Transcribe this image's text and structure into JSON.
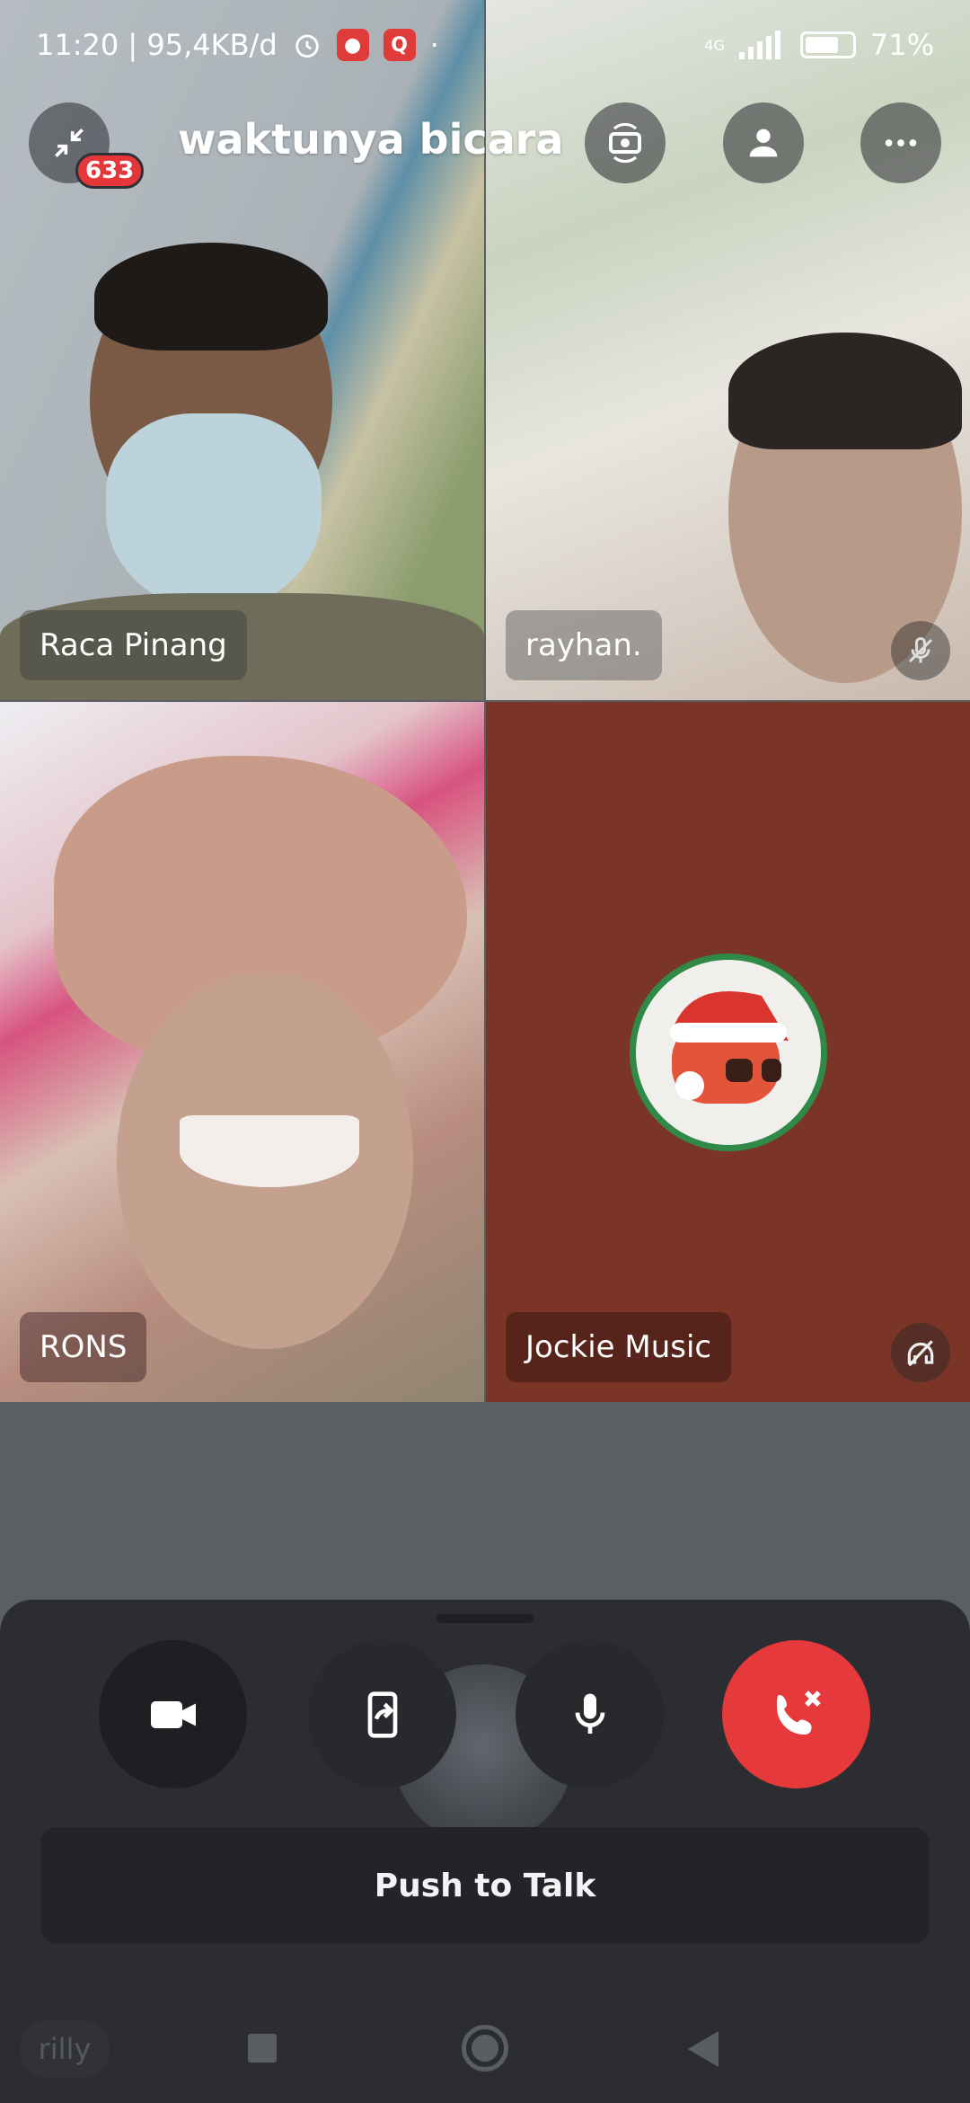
{
  "status_bar": {
    "time_and_speed": "11:20 | 95,4KB/d",
    "network": "4G",
    "battery_percent": "71%",
    "battery_level": 0.71
  },
  "header": {
    "minimize_icon": "collapse-arrows-icon",
    "notification_badge": "633",
    "channel_title": "waktunya bicara",
    "switch_camera_icon": "camera-rotate-icon",
    "participants_icon": "person-icon",
    "more_icon": "more-dots-icon"
  },
  "participants": [
    {
      "name": "Raca Pinang"
    },
    {
      "name": "rayhan.",
      "status_icon": "mic-muted-icon"
    },
    {
      "name": "RONS"
    },
    {
      "name": "Jockie Music",
      "status_icon": "deafened-headphones-icon",
      "tile_color": "#7a3527"
    }
  ],
  "controls": {
    "video_icon": "video-camera-icon",
    "share_icon": "screen-share-icon",
    "mic_icon": "microphone-icon",
    "end_call_icon": "hang-up-icon",
    "end_call_color": "#e5393c",
    "push_to_talk_label": "Push to Talk"
  },
  "navbar": {
    "app_label": "rilly"
  }
}
